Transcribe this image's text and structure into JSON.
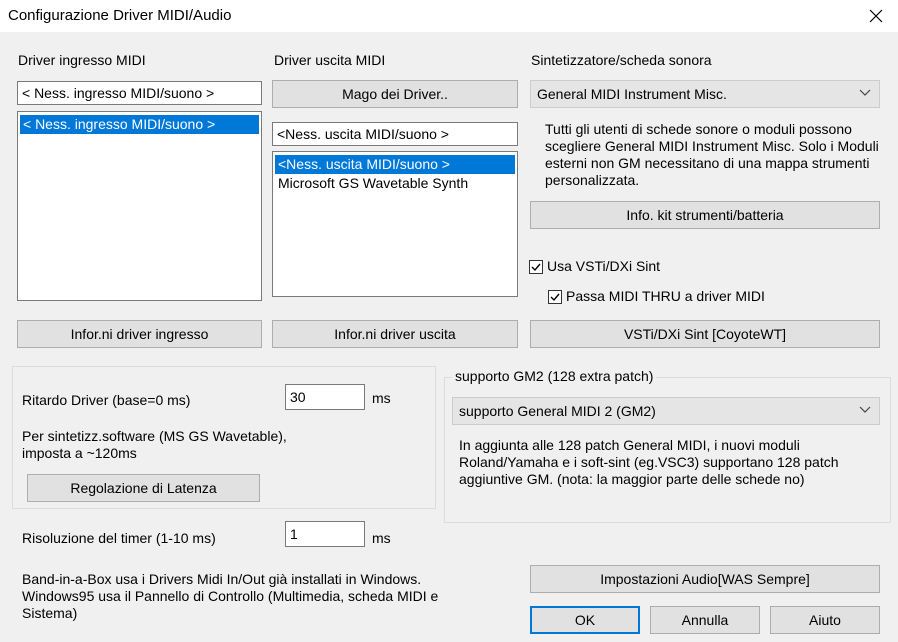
{
  "window": {
    "title": "Configurazione Driver MIDI/Audio"
  },
  "midi_in": {
    "label": "Driver ingresso MIDI",
    "current": "< Ness. ingresso MIDI/suono >",
    "items": [
      "< Ness. ingresso MIDI/suono >"
    ],
    "info_button": "Infor.ni driver ingresso"
  },
  "midi_out": {
    "label": "Driver uscita MIDI",
    "wizard_button": "Mago dei Driver..",
    "current": "<Ness. uscita MIDI/suono >",
    "items": [
      "<Ness. uscita MIDI/suono >",
      "Microsoft GS Wavetable Synth"
    ],
    "info_button": "Infor.ni driver uscita"
  },
  "synth": {
    "label": "Sintetizzatore/scheda sonora",
    "selected": "General MIDI Instrument Misc.",
    "description": "Tutti gli utenti di schede sonore o moduli possono scegliere General MIDI Instrument Misc. Solo i Moduli esterni non GM necessitano di una mappa strumenti personalizzata.",
    "kit_button": "Info. kit strumenti/batteria",
    "use_vsti_label": "Usa VSTi/DXi Sint",
    "use_vsti_checked": true,
    "midi_thru_label": "Passa MIDI THRU a driver MIDI",
    "midi_thru_checked": true,
    "vsti_button": "VSTi/DXi Sint [CoyoteWT]"
  },
  "latency": {
    "delay_label": "Ritardo Driver (base=0 ms)",
    "delay_value": "30",
    "delay_unit": "ms",
    "note": "Per sintetizz.software (MS GS Wavetable), imposta a ~120ms",
    "adjust_button": "Regolazione di Latenza"
  },
  "gm2": {
    "label": "supporto GM2 (128 extra patch)",
    "selected": "supporto General MIDI 2 (GM2)",
    "description": "In aggiunta alle 128 patch General MIDI, i nuovi moduli Roland/Yamaha e i soft-sint (eg.VSC3) supportano 128 patch aggiuntive GM. (nota: la maggior parte delle schede no)"
  },
  "timer": {
    "label": "Risoluzione del timer (1-10 ms)",
    "value": "1",
    "unit": "ms"
  },
  "footer": {
    "note": "Band-in-a-Box usa i Drivers Midi In/Out già installati in Windows. Windows95 usa il Pannello di Controllo (Multimedia, scheda MIDI e Sistema)",
    "audio_button": "Impostazioni Audio[WAS Sempre]",
    "ok_button": "OK",
    "cancel_button": "Annulla",
    "help_button": "Aiuto"
  },
  "colors": {
    "selection": "#0078d7",
    "default_button_border": "#0078d7",
    "dialog_bg": "#f0f0f0"
  }
}
